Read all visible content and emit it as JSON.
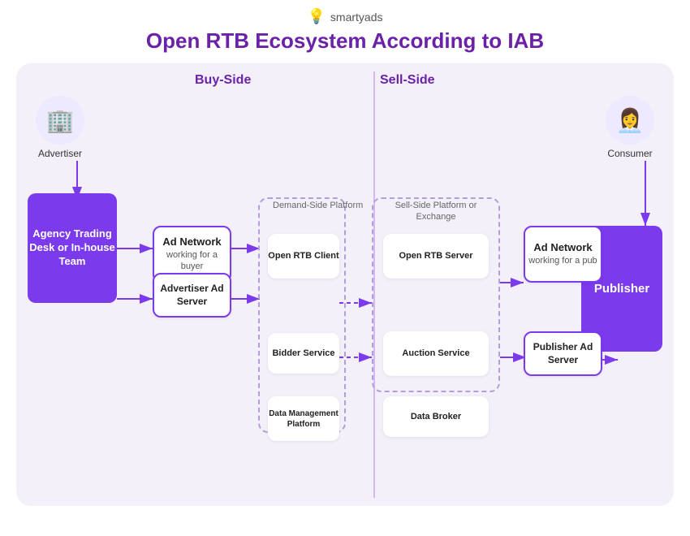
{
  "logo": {
    "text": "smartyads",
    "icon": "💡"
  },
  "title": "Open RTB Ecosystem According to IAB",
  "sections": {
    "buy_side": "Buy-Side",
    "sell_side": "Sell-Side"
  },
  "boxes": {
    "advertiser_label": "Advertiser",
    "consumer_label": "Consumer",
    "agency": "Agency Trading Desk or In-house Team",
    "publisher": "Publisher",
    "ad_network_buyer_title": "Ad Network",
    "ad_network_buyer_sub": "working for a buyer",
    "ad_network_pub_title": "Ad Network",
    "ad_network_pub_sub": "working for a pub",
    "dsp_label": "Demand-Side Platform",
    "open_rtb_client": "Open RTB Client",
    "bidder_service": "Bidder Service",
    "data_mgmt": "Data Management Platform",
    "ssp_label": "Sell-Side Platform or Exchange",
    "open_rtb_server": "Open RTB Server",
    "auction_service": "Auction Service",
    "data_broker": "Data Broker",
    "advertiser_ad_server": "Advertiser Ad Server",
    "publisher_ad_server_title": "Publisher",
    "publisher_ad_server_sub": "Ad Server"
  }
}
